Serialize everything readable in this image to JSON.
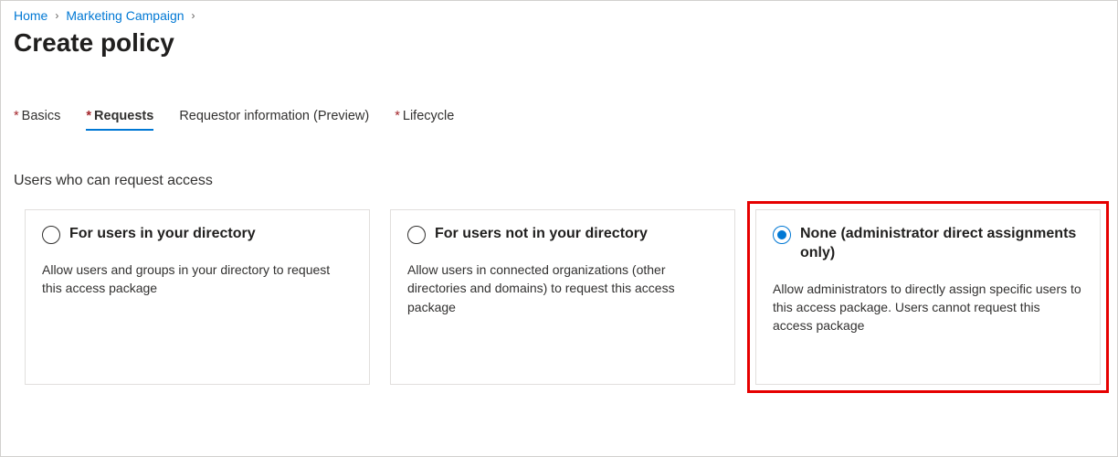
{
  "breadcrumb": {
    "items": [
      {
        "label": "Home"
      },
      {
        "label": "Marketing Campaign"
      }
    ]
  },
  "page": {
    "title": "Create policy"
  },
  "tabs": [
    {
      "label": "Basics",
      "required": true,
      "active": false
    },
    {
      "label": "Requests",
      "required": true,
      "active": true
    },
    {
      "label": "Requestor information (Preview)",
      "required": false,
      "active": false
    },
    {
      "label": "Lifecycle",
      "required": true,
      "active": false
    }
  ],
  "section": {
    "heading": "Users who can request access"
  },
  "options": [
    {
      "title": "For users in your directory",
      "description": "Allow users and groups in your directory to request this access package",
      "selected": false
    },
    {
      "title": "For users not in your directory",
      "description": "Allow users in connected organizations (other directories and domains) to request this access package",
      "selected": false
    },
    {
      "title": "None (administrator direct assignments only)",
      "description": "Allow administrators to directly assign specific users to this access package. Users cannot request this access package",
      "selected": true
    }
  ],
  "asterisk": "*"
}
